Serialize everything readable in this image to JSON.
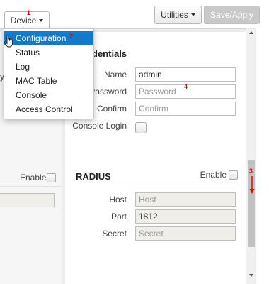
{
  "toolbar": {
    "device_label": "Device",
    "utilities_label": "Utilities",
    "save_label": "Save/Apply"
  },
  "device_menu": {
    "items": [
      "Configuration",
      "Status",
      "Log",
      "MAC Table",
      "Console",
      "Access Control"
    ],
    "active_index": 0
  },
  "left_panel": {
    "enable_label": "Enable",
    "partial_label": "y"
  },
  "credentials": {
    "title_visible": "dentials",
    "name_label": "Name",
    "name_value": "admin",
    "password_label": "Password",
    "password_placeholder": "Password",
    "confirm_label": "Confirm",
    "confirm_placeholder": "Confirm",
    "console_login_label": "Console Login"
  },
  "radius": {
    "title": "RADIUS",
    "enable_label": "Enable",
    "host_label": "Host",
    "host_placeholder": "Host",
    "port_label": "Port",
    "port_value": "1812",
    "secret_label": "Secret",
    "secret_placeholder": "Secret"
  },
  "annotations": {
    "n1": "1",
    "n2": "2",
    "n3": "3",
    "n4": "4"
  },
  "colors": {
    "menu_highlight": "#1479c9",
    "annotation": "#ee0000",
    "panel_bg": "#ececec"
  }
}
